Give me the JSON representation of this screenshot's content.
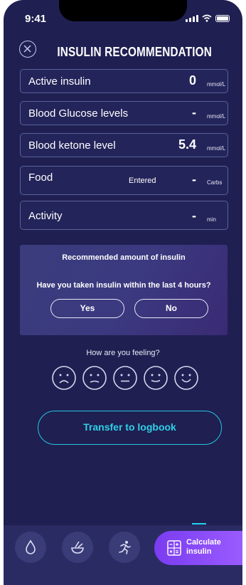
{
  "status": {
    "time": "9:41"
  },
  "header": {
    "title": "INSULIN RECOMMENDATION"
  },
  "rows": [
    {
      "label": "Active insulin",
      "value": "0",
      "unit": "mmol/L"
    },
    {
      "label": "Blood Glucose levels",
      "value": "-",
      "unit": "mmol/L"
    },
    {
      "label": "Blood ketone level",
      "value": "5.4",
      "unit": "mmol/L"
    },
    {
      "label": "Food",
      "status": "Entered",
      "value": "-",
      "unit": "Carbs"
    },
    {
      "label": "Activity",
      "value": "-",
      "unit": "min"
    }
  ],
  "recommendation": {
    "title": "Recommended amount of insulin",
    "question": "Have you taken insulin within the last 4 hours?",
    "yes_label": "Yes",
    "no_label": "No"
  },
  "feeling": {
    "prompt": "How are you feeling?",
    "faces": [
      "very-sad-face-icon",
      "sad-face-icon",
      "neutral-face-icon",
      "slight-smile-face-icon",
      "happy-face-icon"
    ]
  },
  "transfer_label": "Transfer to logbook",
  "bottom_nav": {
    "items": [
      "drop-icon",
      "food-bowl-icon",
      "running-icon"
    ],
    "calculate_label_line1": "Calculate",
    "calculate_label_line2": "insulin"
  },
  "colors": {
    "background": "#1f1f52",
    "accent_cyan": "#25c6dd",
    "accent_purple": "#8b4df5"
  }
}
